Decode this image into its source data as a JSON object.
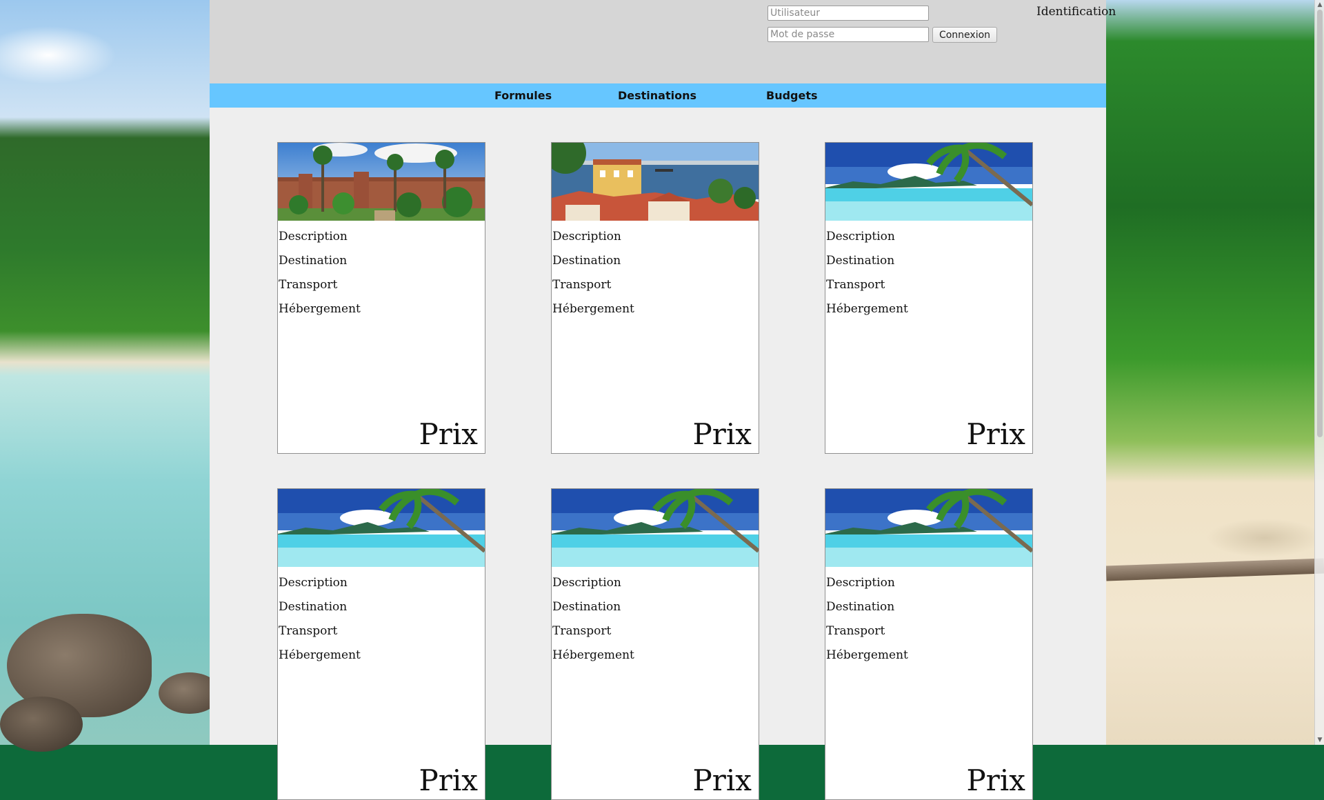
{
  "header": {
    "login": {
      "username_placeholder": "Utilisateur",
      "password_placeholder": "Mot de passe",
      "submit_label": "Connexion"
    },
    "identification_title": "Identification"
  },
  "nav": {
    "formules": "Formules",
    "destinations": "Destinations",
    "budgets": "Budgets"
  },
  "cards": [
    {
      "image": "red-fortress-palm-garden",
      "description": "Description",
      "destination": "Destination",
      "transport": "Transport",
      "hebergement": "Hébergement",
      "price": "Prix"
    },
    {
      "image": "coastal-town-rooftops",
      "description": "Description",
      "destination": "Destination",
      "transport": "Transport",
      "hebergement": "Hébergement",
      "price": "Prix"
    },
    {
      "image": "tropical-lagoon-palm",
      "description": "Description",
      "destination": "Destination",
      "transport": "Transport",
      "hebergement": "Hébergement",
      "price": "Prix"
    },
    {
      "image": "tropical-lagoon-palm",
      "description": "Description",
      "destination": "Destination",
      "transport": "Transport",
      "hebergement": "Hébergement",
      "price": "Prix"
    },
    {
      "image": "tropical-lagoon-palm",
      "description": "Description",
      "destination": "Destination",
      "transport": "Transport",
      "hebergement": "Hébergement",
      "price": "Prix"
    },
    {
      "image": "tropical-lagoon-palm",
      "description": "Description",
      "destination": "Destination",
      "transport": "Transport",
      "hebergement": "Hébergement",
      "price": "Prix"
    }
  ],
  "colors": {
    "nav_bar": "#66c6ff",
    "header": "#d6d6d6",
    "content_bg": "#eeeeee"
  }
}
